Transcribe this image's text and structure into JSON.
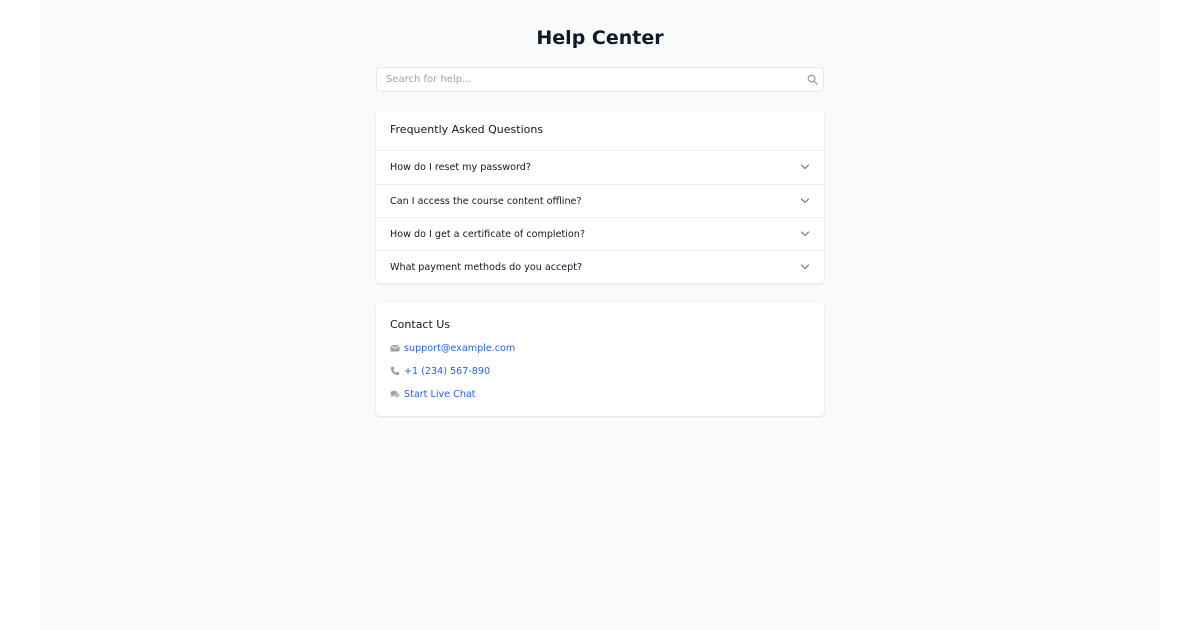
{
  "header": {
    "title": "Help Center"
  },
  "search": {
    "placeholder": "Search for help...",
    "value": "",
    "icon": "search-icon"
  },
  "faq": {
    "title": "Frequently Asked Questions",
    "items": [
      {
        "question": "How do I reset my password?",
        "icon": "chevron-down-icon"
      },
      {
        "question": "Can I access the course content offline?",
        "icon": "chevron-down-icon"
      },
      {
        "question": "How do I get a certificate of completion?",
        "icon": "chevron-down-icon"
      },
      {
        "question": "What payment methods do you accept?",
        "icon": "chevron-down-icon"
      }
    ]
  },
  "contact": {
    "title": "Contact Us",
    "items": [
      {
        "label": "support@example.com",
        "icon": "envelope-icon"
      },
      {
        "label": "+1 (234) 567-890",
        "icon": "phone-icon"
      },
      {
        "label": "Start Live Chat",
        "icon": "chat-icon"
      }
    ]
  },
  "colors": {
    "page_background": "#f9fafb",
    "card_background": "#ffffff",
    "link": "#2563eb",
    "icon_gray": "#9ca3af",
    "text": "#111827"
  }
}
